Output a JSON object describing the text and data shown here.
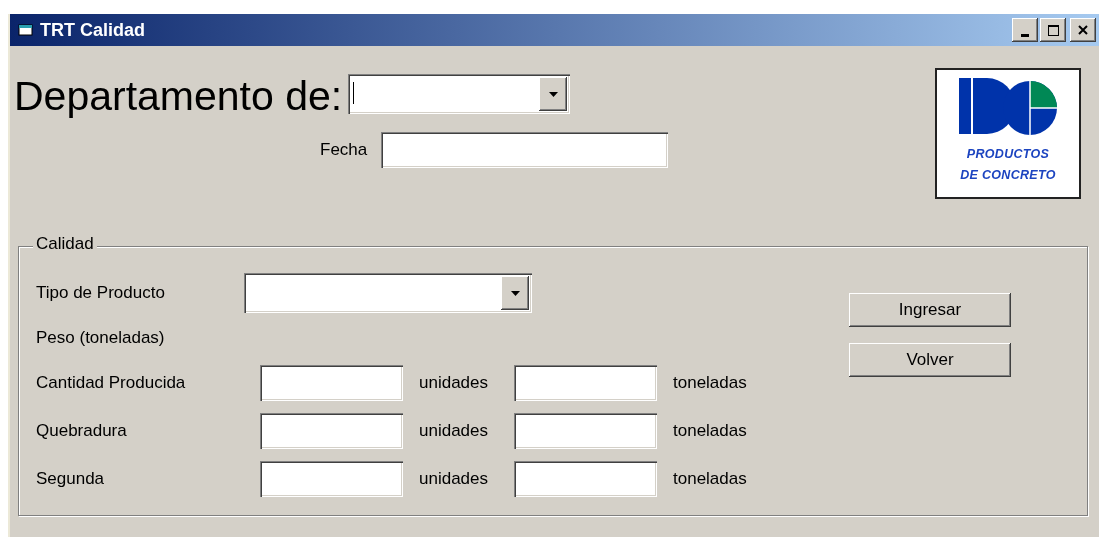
{
  "window": {
    "title": "TRT Calidad"
  },
  "header": {
    "department_label": "Departamento de:",
    "date_label": "Fecha"
  },
  "logo": {
    "line_1": "PRODUCTOS",
    "line_2": "DE CONCRETO"
  },
  "quality": {
    "legend": "Calidad",
    "product_type_label": "Tipo de Producto",
    "weight_label": "Peso (toneladas)",
    "rows": [
      {
        "label": "Cantidad Producida",
        "unit_1": "unidades",
        "unit_2": "toneladas"
      },
      {
        "label": "Quebradura",
        "unit_1": "unidades",
        "unit_2": "toneladas"
      },
      {
        "label": "Segunda",
        "unit_1": "unidades",
        "unit_2": "toneladas"
      }
    ],
    "buttons": [
      "Ingresar",
      "Volver"
    ]
  }
}
